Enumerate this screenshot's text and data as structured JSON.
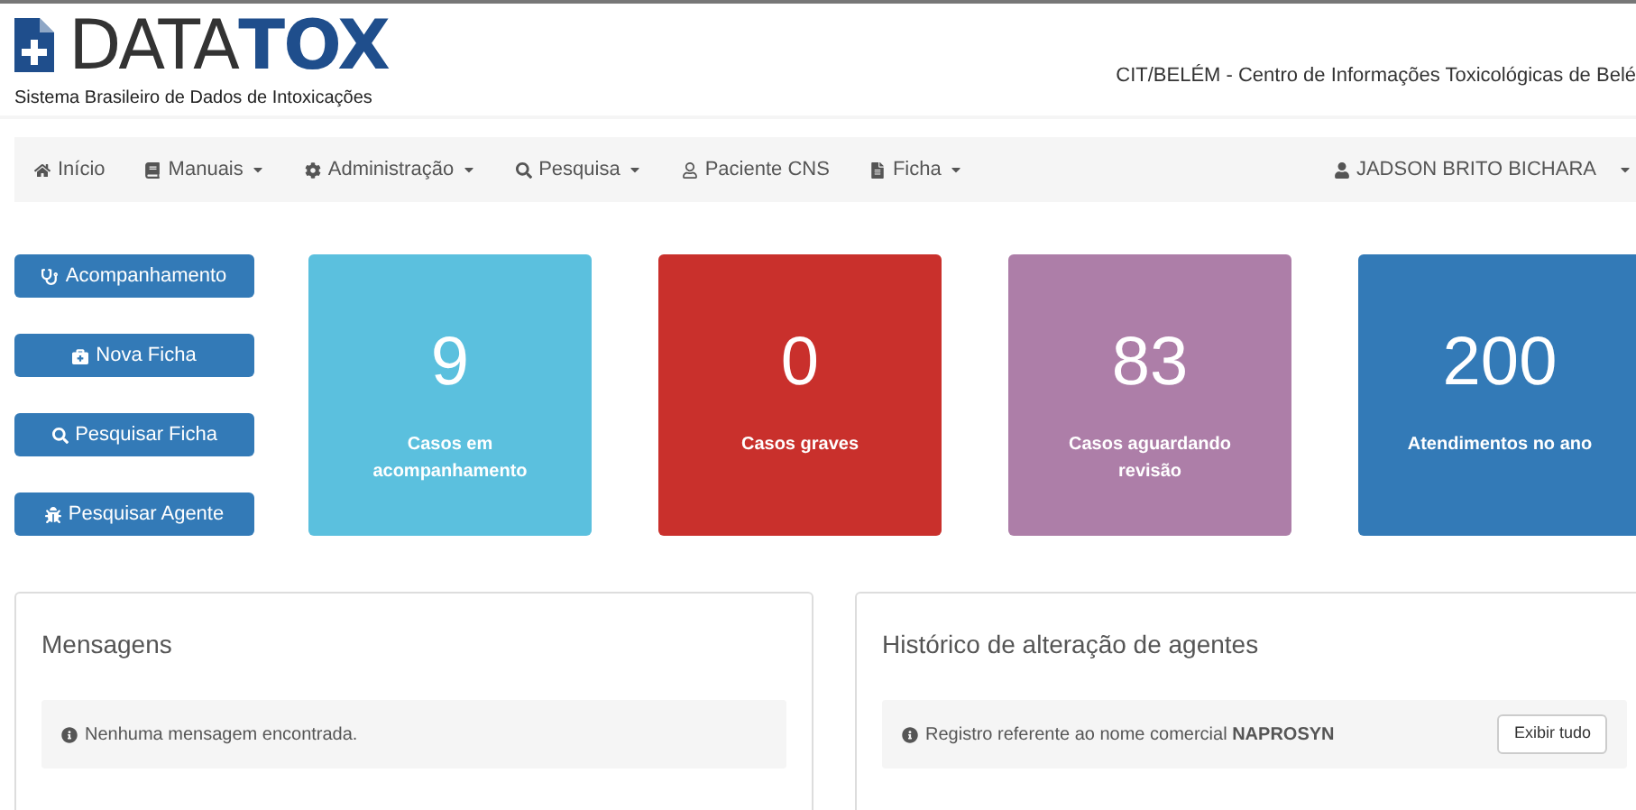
{
  "header": {
    "logo_parts": [
      "DATA",
      "TOX"
    ],
    "subtitle": "Sistema Brasileiro de Dados de Intoxicações",
    "center_name": "CIT/BELÉM - Centro de Informações Toxicológicas de Belé"
  },
  "navbar": {
    "items": [
      {
        "label": "Início",
        "dropdown": false
      },
      {
        "label": "Manuais",
        "dropdown": true
      },
      {
        "label": "Administração",
        "dropdown": true
      },
      {
        "label": "Pesquisa",
        "dropdown": true
      },
      {
        "label": "Paciente CNS",
        "dropdown": false
      },
      {
        "label": "Ficha",
        "dropdown": true
      }
    ],
    "user": {
      "label": "JADSON BRITO BICHARA",
      "dropdown": true
    }
  },
  "actions": [
    {
      "label": "Acompanhamento"
    },
    {
      "label": "Nova Ficha"
    },
    {
      "label": "Pesquisar Ficha"
    },
    {
      "label": "Pesquisar Agente"
    }
  ],
  "stats": [
    {
      "value": "9",
      "label": "Casos em acompanhamento",
      "color": "#5bc0de"
    },
    {
      "value": "0",
      "label": "Casos graves",
      "color": "#c9302c"
    },
    {
      "value": "83",
      "label": "Casos aguardando revisão",
      "color": "#ad7ea8"
    },
    {
      "value": "200",
      "label": "Atendimentos no ano",
      "color": "#337ab7"
    }
  ],
  "panels": [
    {
      "title": "Mensagens",
      "message": "Nenhuma mensagem encontrada."
    },
    {
      "title": "Histórico de alteração de agentes",
      "message": "Registro referente ao nome comercial **NAPROSYN**",
      "button": "Exibir tudo"
    }
  ]
}
